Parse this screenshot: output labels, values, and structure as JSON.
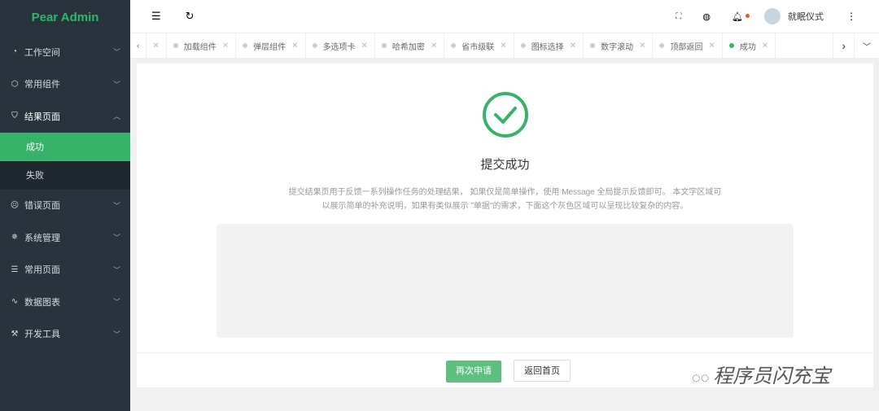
{
  "app": {
    "title": "Pear Admin"
  },
  "sidebar": {
    "items": [
      {
        "label": "工作空间",
        "icon": "dashboard-icon"
      },
      {
        "label": "常用组件",
        "icon": "cube-icon"
      },
      {
        "label": "结果页面",
        "icon": "shield-icon",
        "children": [
          {
            "label": "成功"
          },
          {
            "label": "失败"
          }
        ]
      },
      {
        "label": "错误页面",
        "icon": "face-icon"
      },
      {
        "label": "系统管理",
        "icon": "gear-icon"
      },
      {
        "label": "常用页面",
        "icon": "layers-icon"
      },
      {
        "label": "数据图表",
        "icon": "pulse-icon"
      },
      {
        "label": "开发工具",
        "icon": "tools-icon"
      }
    ]
  },
  "header": {
    "user": "就眠仪式"
  },
  "tabs": [
    "加载组件",
    "弹层组件",
    "多选项卡",
    "哈希加密",
    "省市级联",
    "图标选择",
    "数字滚动",
    "顶部返回",
    "成功"
  ],
  "result": {
    "title": "提交成功",
    "desc_line1": "提交结果页用于反馈一系列操作任务的处理结果， 如果仅是简单操作，使用 Message 全局提示反馈即可。 本文字区域可",
    "desc_line2": "以展示简单的补充说明，如果有类似展示 \"单据\"的需求，下面这个灰色区域可以呈现比较复杂的内容。",
    "primary": "再次申请",
    "secondary": "返回首页"
  },
  "watermark": "程序员闪充宝",
  "colors": {
    "accent": "#36b368",
    "sidebar": "#28333e"
  }
}
